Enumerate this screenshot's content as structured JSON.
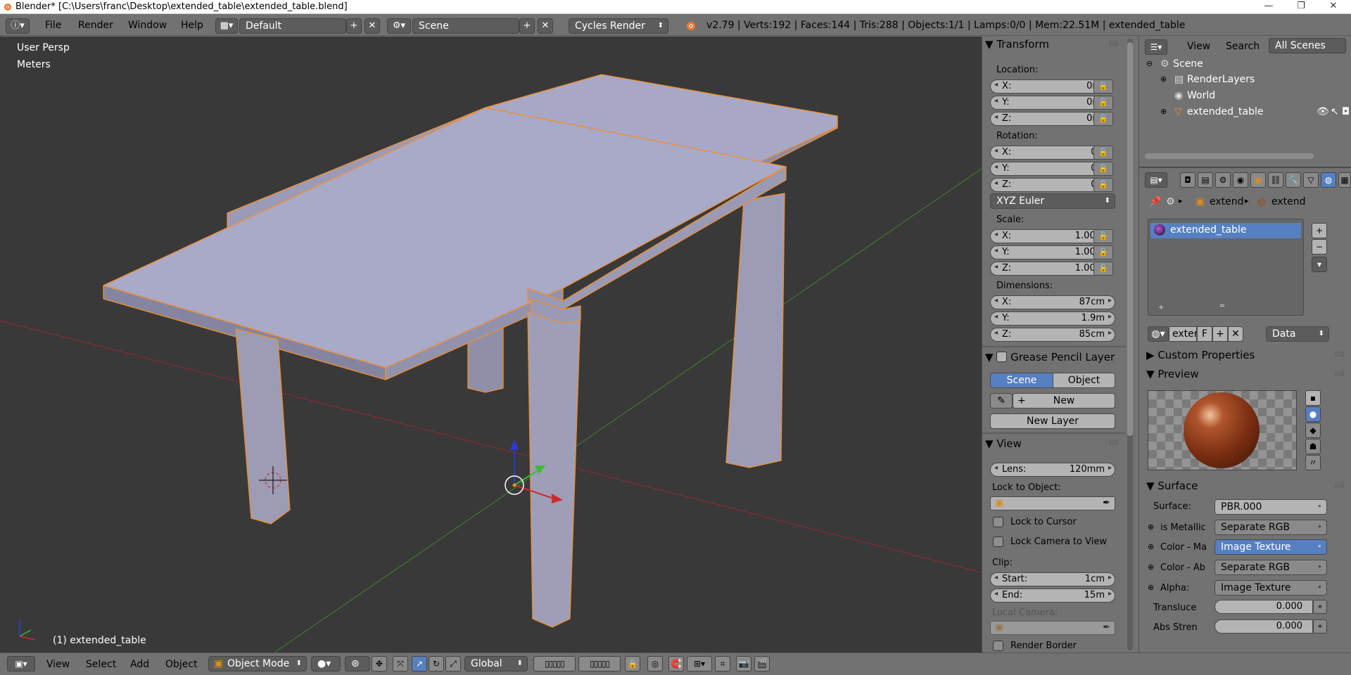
{
  "window": {
    "title": "Blender* [C:\\Users\\franc\\Desktop\\extended_table\\extended_table.blend]",
    "minimize": "—",
    "maximize": "❐",
    "close": "✕"
  },
  "info_header": {
    "menus": [
      "File",
      "Render",
      "Window",
      "Help"
    ],
    "layout": "Default",
    "scene": "Scene",
    "engine": "Cycles Render",
    "stats": "v2.79 | Verts:192 | Faces:144 | Tris:288 | Objects:1/1 | Lamps:0/0 | Mem:22.51M | extended_table"
  },
  "viewport": {
    "view_name": "User Persp",
    "units": "Meters",
    "object_label": "(1) extended_table",
    "colors": {
      "background": "#393939",
      "object": "#a6a6c4",
      "outline": "#f08f2c",
      "x_axis": "#8a2b2b",
      "y_axis": "#3d7a2d"
    }
  },
  "n_panel": {
    "transform_header": "Transform",
    "location_label": "Location:",
    "location": {
      "x": "0m",
      "y": "0m",
      "z": "0m"
    },
    "rotation_label": "Rotation:",
    "rotation": {
      "x": "0°",
      "y": "0°",
      "z": "0°"
    },
    "rotation_mode": "XYZ Euler",
    "scale_label": "Scale:",
    "scale": {
      "x": "1.000",
      "y": "1.000",
      "z": "1.000"
    },
    "dimensions_label": "Dimensions:",
    "dimensions": {
      "x": "87cm",
      "y": "1.9m",
      "z": "85cm"
    },
    "axis_labels": {
      "x": "X:",
      "y": "Y:",
      "z": "Z:"
    },
    "grease_header": "Grease Pencil Layer",
    "grease_scene": "Scene",
    "grease_object": "Object",
    "grease_new": "New",
    "grease_new_layer": "New Layer",
    "view_header": "View",
    "lens_label": "Lens:",
    "lens_value": "120mm",
    "lock_to_object": "Lock to Object:",
    "lock_to_cursor": "Lock to Cursor",
    "lock_camera": "Lock Camera to View",
    "clip_label": "Clip:",
    "clip_start_label": "Start:",
    "clip_start": "1cm",
    "clip_end_label": "End:",
    "clip_end": "15m",
    "local_camera": "Local Camera:",
    "render_border": "Render Border"
  },
  "outliner": {
    "view": "View",
    "search": "Search",
    "filter": "All Scenes",
    "items": [
      "Scene",
      "RenderLayers",
      "World",
      "extended_table"
    ]
  },
  "properties": {
    "breadcrumb_1": "extend",
    "breadcrumb_2": "extend",
    "material_slot": "extended_table",
    "datablock_name": "exten",
    "fake_user": "F",
    "link_mode": "Data",
    "custom_properties": "Custom Properties",
    "preview": "Preview",
    "surface_header": "Surface",
    "surface_label": "Surface:",
    "surface_value": "PBR.000",
    "inputs": [
      {
        "label": "is Metallic",
        "value": "Separate RGB"
      },
      {
        "label": "Color - Ma",
        "value": "Image Texture"
      },
      {
        "label": "Color - Ab",
        "value": "Separate RGB"
      },
      {
        "label": "Alpha:",
        "value": "Image Texture"
      }
    ],
    "translucency_label": "Transluce",
    "translucency_value": "0.000",
    "abs_strength_label": "Abs Stren",
    "abs_strength_value": "0.000"
  },
  "bottom_bar": {
    "menus": [
      "View",
      "Select",
      "Add",
      "Object"
    ],
    "mode": "Object Mode",
    "orientation": "Global"
  }
}
